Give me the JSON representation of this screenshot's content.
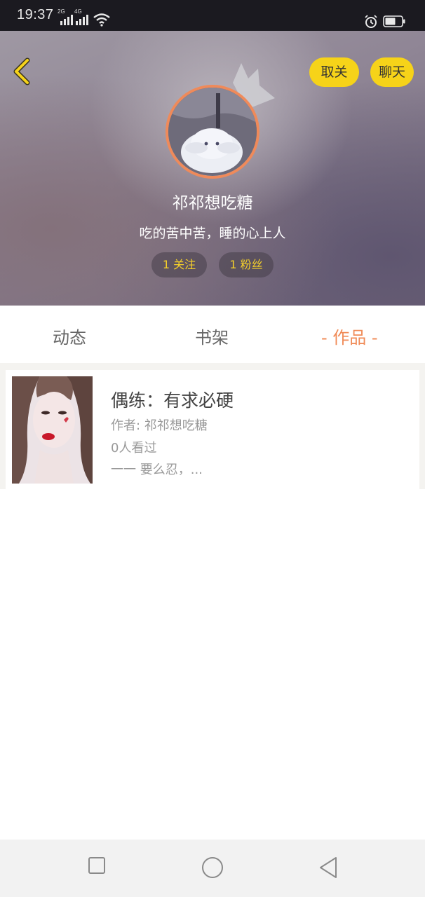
{
  "status_bar": {
    "time": "19:37",
    "network_1": "2G",
    "network_2": "4G",
    "icons": [
      "signal-icon",
      "wifi-icon",
      "alarm-icon",
      "battery-icon"
    ]
  },
  "header": {
    "back_icon": "chevron-left-icon",
    "unfollow_label": "取关",
    "chat_label": "聊天",
    "username": "祁祁想吃糖",
    "bio": "吃的苦中苦，睡的心上人",
    "following_label": "1 关注",
    "fans_label": "1 粉丝"
  },
  "tabs": [
    {
      "label": "动态",
      "active": false
    },
    {
      "label": "书架",
      "active": false
    },
    {
      "label": "- 作品 -",
      "active": true
    }
  ],
  "works": [
    {
      "title": "偶练：有求必硬",
      "author": "作者: 祁祁想吃糖",
      "views": "0人看过",
      "excerpt": "一一 要么忍，..."
    }
  ],
  "nav_bar": {
    "icons": [
      "recents-square-icon",
      "home-circle-icon",
      "back-triangle-icon"
    ]
  },
  "colors": {
    "accent_yellow": "#f6d319",
    "accent_orange": "#f08a56",
    "chip_text": "#f4cf2a"
  }
}
